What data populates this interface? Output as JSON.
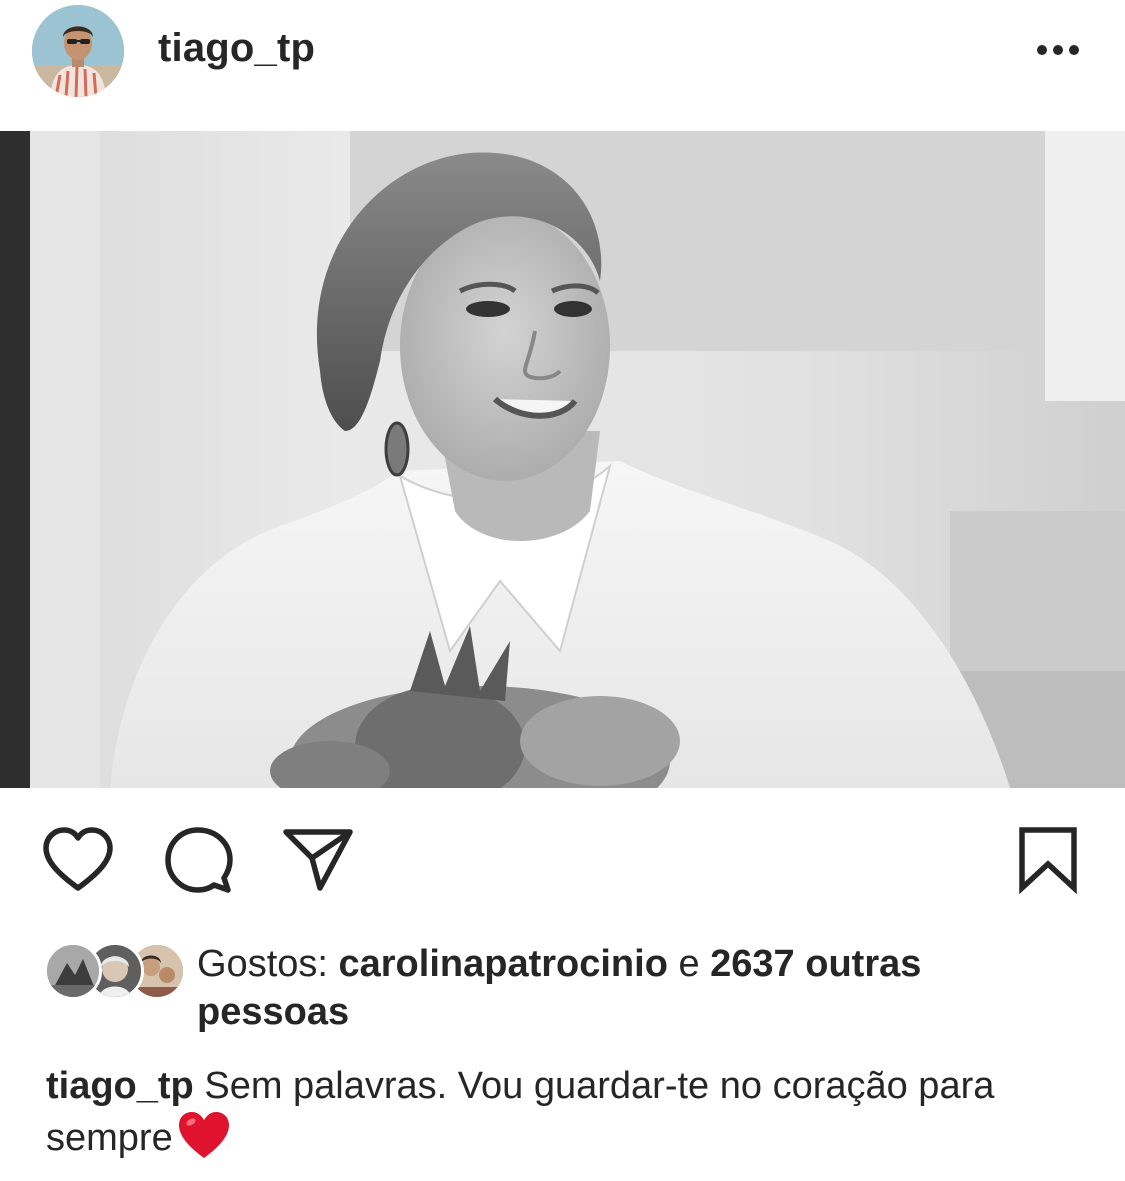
{
  "post": {
    "author": {
      "username": "tiago_tp"
    },
    "icons": {
      "more": "more-horizontal-icon",
      "like": "heart-outline-icon",
      "comment": "comment-bubble-icon",
      "share": "paper-plane-icon",
      "save": "bookmark-icon",
      "caption_emoji": "red-heart-emoji-icon"
    },
    "likes": {
      "prefix": "Gostos: ",
      "liker": "carolinapatrocinio",
      "conjunction": " e ",
      "count_text": "2637 outras pessoas"
    },
    "caption": {
      "username": "tiago_tp",
      "text": "Sem palavras. Vou guardar-te no coração para sempre"
    },
    "colors": {
      "text": "#262626",
      "heart_red": "#e0132f",
      "background": "#ffffff"
    }
  }
}
